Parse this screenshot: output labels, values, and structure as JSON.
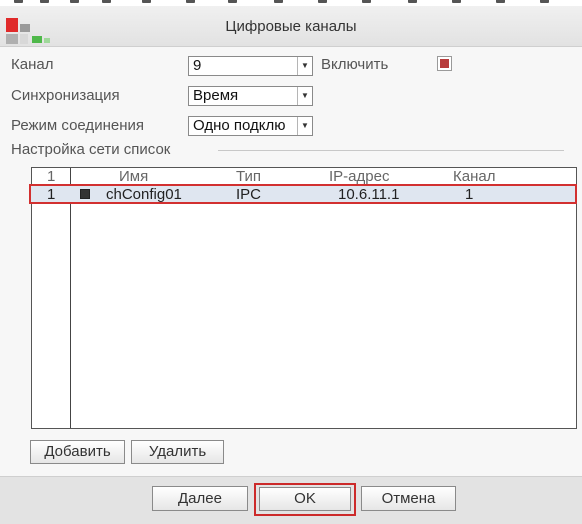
{
  "window": {
    "title": "Цифровые каналы"
  },
  "form": {
    "channel_label": "Канал",
    "channel_value": "9",
    "enable_label": "Включить",
    "enable_checked": true,
    "sync_label": "Синхронизация",
    "sync_value": "Время",
    "mode_label": "Режим соединения",
    "mode_value": "Одно подклю"
  },
  "network_list": {
    "section_title": "Настройка сети список",
    "columns": [
      "1",
      "Имя",
      "Тип",
      "IP-адрес",
      "Канал"
    ],
    "rows": [
      {
        "index": "1",
        "checked": true,
        "name": "chConfig01",
        "type": "IPC",
        "ip": "10.6.11.1",
        "channel": "1"
      }
    ]
  },
  "list_buttons": {
    "add": "Добавить",
    "delete": "Удалить"
  },
  "footer": {
    "next": "Далее",
    "ok": "OK",
    "cancel": "Отмена"
  },
  "colors": {
    "accent_red": "#d23030",
    "checkbox_mark": "#b83b3b"
  },
  "icons": {
    "logo": "logo-icon",
    "dropdown": "chevron-down-icon"
  }
}
